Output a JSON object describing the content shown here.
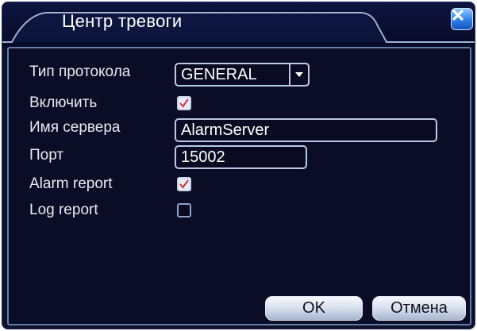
{
  "window": {
    "title": "Центр тревоги"
  },
  "form": {
    "protocol_label": "Тип протокола",
    "protocol_value": "GENERAL",
    "enable_label": "Включить",
    "enable_checked": true,
    "server_label": "Имя сервера",
    "server_value": "AlarmServer",
    "port_label": "Порт",
    "port_value": "15002",
    "alarm_report_label": "Alarm report",
    "alarm_report_checked": true,
    "log_report_label": "Log report",
    "log_report_checked": false
  },
  "buttons": {
    "ok_label": "OK",
    "cancel_label": "Отмена"
  },
  "icons": {
    "close": "close-icon",
    "dropdown": "chevron-down-icon",
    "check": "check-icon"
  },
  "colors": {
    "background": "#0b0c25",
    "accent": "#2e7fe6",
    "check_mark": "#d2323a"
  }
}
